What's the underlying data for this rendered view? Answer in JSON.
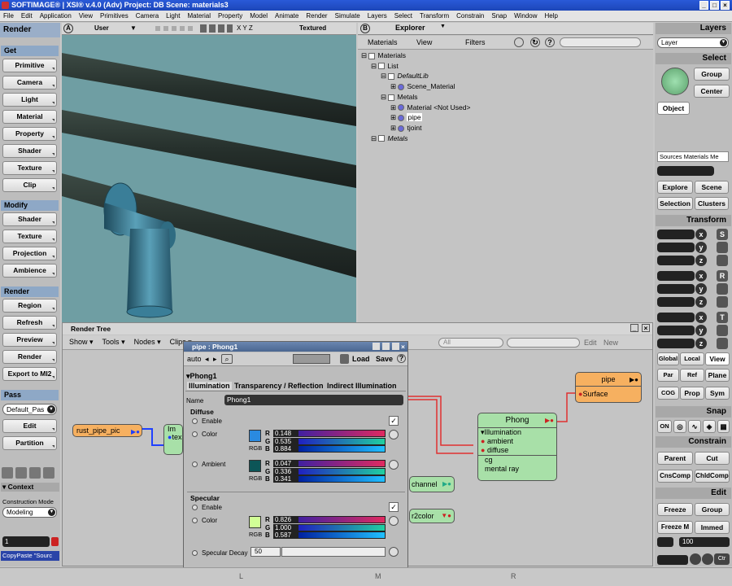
{
  "window": {
    "title": "SOFTIMAGE® | XSI® v.4.0 (Adv) Project: DB    Scene: materials3"
  },
  "menu": [
    "File",
    "Edit",
    "Application",
    "View",
    "Primitives",
    "Camera",
    "Light",
    "Material",
    "Property",
    "Model",
    "Animate",
    "Render",
    "Simulate",
    "Layers",
    "Select",
    "Transform",
    "Constrain",
    "Snap",
    "Window",
    "Help"
  ],
  "left_panel": {
    "title": "Render",
    "get": {
      "header": "Get",
      "buttons": [
        "Primitive",
        "Camera",
        "Light",
        "Material",
        "Property",
        "Shader",
        "Texture",
        "Clip"
      ]
    },
    "modify": {
      "header": "Modify",
      "buttons": [
        "Shader",
        "Texture",
        "Projection",
        "Ambience"
      ]
    },
    "render": {
      "header": "Render",
      "buttons": [
        "Region",
        "Refresh",
        "Preview",
        "Render",
        "Export to MI2"
      ]
    },
    "pass": {
      "header": "Pass",
      "value": "Default_Pas",
      "buttons": [
        "Edit",
        "Partition"
      ]
    },
    "context": {
      "header": "Context",
      "mode_label": "Construction Mode",
      "mode_value": "Modeling",
      "field_value": "1",
      "copypaste": "CopyPaste \"Sourc"
    }
  },
  "viewport": {
    "label": "A",
    "camera": "User",
    "axes": "X Y Z",
    "display": "Textured"
  },
  "explorer": {
    "label": "B",
    "title": "Explorer",
    "toolbar": {
      "scope": "Materials",
      "view": "View",
      "filters": "Filters"
    },
    "tree": [
      {
        "text": "Materials",
        "depth": 0
      },
      {
        "text": "List",
        "depth": 1
      },
      {
        "text": "DefaultLib",
        "depth": 2
      },
      {
        "text": "Scene_Material",
        "depth": 3
      },
      {
        "text": "Metals",
        "depth": 2
      },
      {
        "text": "Material  <Not Used>",
        "depth": 3
      },
      {
        "text": "pipe",
        "depth": 3
      },
      {
        "text": "tjoint",
        "depth": 3
      },
      {
        "text": "Metals",
        "depth": 1
      }
    ]
  },
  "right_panel": {
    "layers": {
      "header": "Layers",
      "value": "Layer"
    },
    "select": {
      "header": "Select",
      "group": "Group",
      "center": "Center",
      "object": "Object",
      "sources": "Sources Materials Me",
      "explore": "Explore",
      "scene": "Scene",
      "selection": "Selection",
      "clusters": "Clusters"
    },
    "transform": {
      "header": "Transform",
      "axes": [
        "x",
        "y",
        "z"
      ],
      "icons": [
        "S",
        "R",
        "T"
      ],
      "global": "Global",
      "local": "Local",
      "view": "View",
      "par": "Par",
      "ref": "Ref",
      "plane": "Plane",
      "cog": "COG",
      "prop": "Prop",
      "sym": "Sym"
    },
    "snap": {
      "header": "Snap",
      "on": "ON"
    },
    "constrain": {
      "header": "Constrain",
      "parent": "Parent",
      "cut": "Cut",
      "cnscomp": "CnsComp",
      "chldcomp": "ChldComp"
    },
    "edit": {
      "header": "Edit",
      "freeze": "Freeze",
      "group": "Group",
      "freezem": "Freeze M",
      "immed": "Immed",
      "value": "100",
      "ctr": "Ctr"
    }
  },
  "render_tree": {
    "title": "Render Tree",
    "menu": [
      "Show",
      "Tools",
      "Nodes",
      "Clips"
    ],
    "right_field": "All",
    "edit": "Edit",
    "new": "New",
    "nodes": {
      "rust": "rust_pipe_pic",
      "image_partial": "Im",
      "image_port": "tex",
      "channel": "channel",
      "r2color": "r2color",
      "phong": {
        "title": "Phong",
        "group": "Illumination",
        "ports": [
          "ambient",
          "diffuse"
        ],
        "extra": [
          "cg",
          "mental ray"
        ]
      },
      "pipe": {
        "title": "pipe",
        "port": "Surface"
      }
    }
  },
  "ppg": {
    "title": "pipe : Phong1",
    "auto": "auto",
    "load": "Load",
    "save": "Save",
    "shader": "Phong1",
    "tabs": [
      "Illumination",
      "Transparency / Reflection",
      "Indirect Illumination"
    ],
    "name_label": "Name",
    "name_value": "Phong1",
    "diffuse": {
      "header": "Diffuse",
      "enable": "Enable",
      "color": {
        "label": "Color",
        "r": "0.148",
        "g": "0.535",
        "b": "0.884",
        "swatch": "#2a8ae0"
      },
      "ambient": {
        "label": "Ambient",
        "r": "0.047",
        "g": "0.336",
        "b": "0.341",
        "swatch": "#0c5557"
      }
    },
    "specular": {
      "header": "Specular",
      "enable": "Enable",
      "color": {
        "label": "Color",
        "r": "0.826",
        "g": "1.000",
        "b": "0.587",
        "swatch": "#d2ff96"
      },
      "decay_label": "Specular Decay",
      "decay_value": "50"
    },
    "channels": {
      "r": "R",
      "g": "G",
      "b": "B",
      "rgb": "RGB"
    }
  },
  "status_bar": {
    "l": "L",
    "m": "M",
    "r": "R"
  }
}
